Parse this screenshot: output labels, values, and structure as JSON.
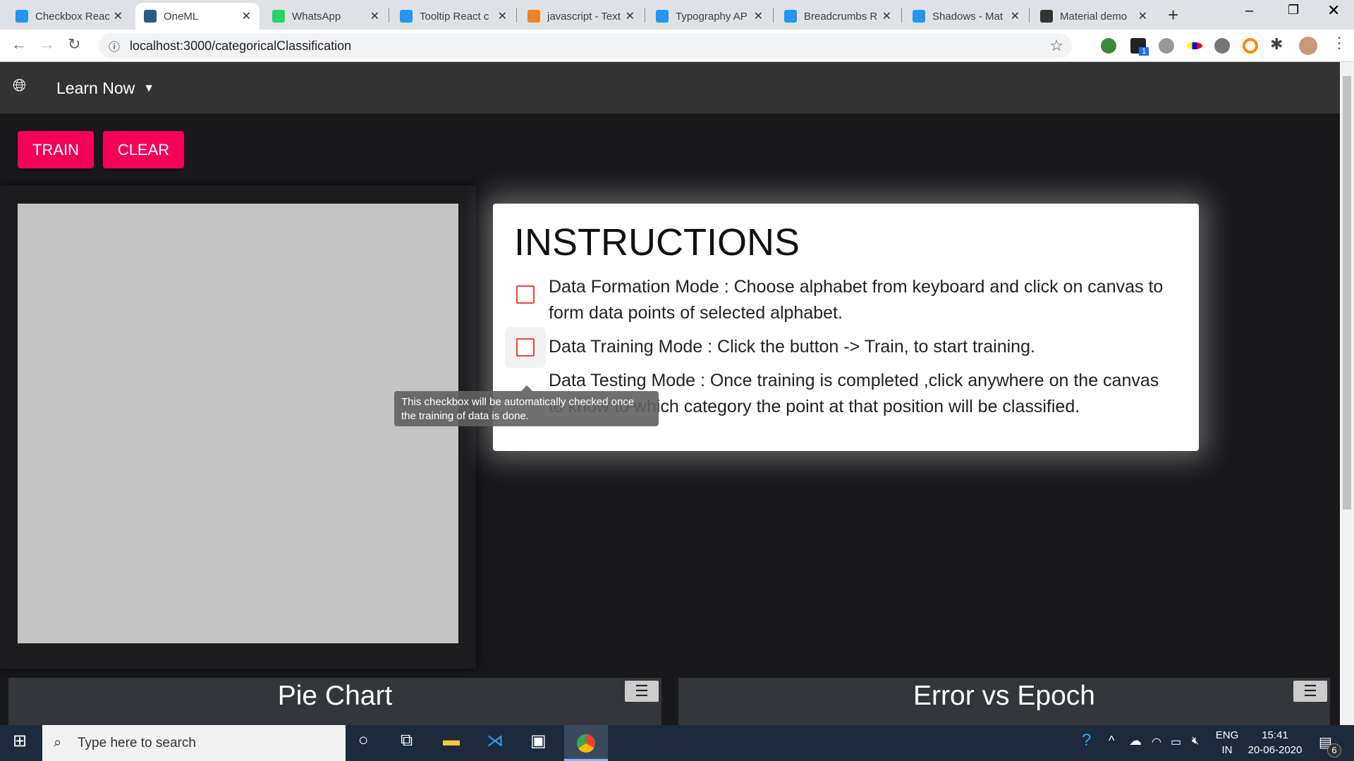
{
  "browser": {
    "tabs": [
      {
        "title": "Checkbox React",
        "color": "#2196f3"
      },
      {
        "title": "OneML",
        "color": "#2a5b86",
        "active": true
      },
      {
        "title": "WhatsApp",
        "color": "#25d366"
      },
      {
        "title": "Tooltip React c",
        "color": "#2196f3"
      },
      {
        "title": "javascript - Text",
        "color": "#f48024"
      },
      {
        "title": "Typography AP",
        "color": "#2196f3"
      },
      {
        "title": "Breadcrumbs R",
        "color": "#2196f3"
      },
      {
        "title": "Shadows - Mat",
        "color": "#2196f3"
      },
      {
        "title": "Material demo",
        "color": "#333333"
      }
    ],
    "new_tab": "+",
    "url": "localhost:3000/categoricalClassification",
    "badge": "1"
  },
  "app": {
    "menu_label": "Learn Now",
    "train": "TRAIN",
    "clear": "CLEAR",
    "instructions": {
      "title": "INSTRUCTIONS",
      "items": [
        "Data Formation Mode : Choose alphabet from keyboard and click on canvas to form data points of selected alphabet.",
        "Data Training Mode : Click the button -> Train, to start training.",
        "Data Testing Mode : Once training is completed ,click anywhere on the canvas to know to which category the point at that position will be classified."
      ]
    },
    "tooltip": "This checkbox will be automatically checked once the training of data is done.",
    "charts": [
      "Pie Chart",
      "Error vs Epoch"
    ]
  },
  "taskbar": {
    "search_placeholder": "Type here to search",
    "lang1": "ENG",
    "lang2": "IN",
    "time": "15:41",
    "date": "20-06-2020",
    "notifications": "6"
  }
}
